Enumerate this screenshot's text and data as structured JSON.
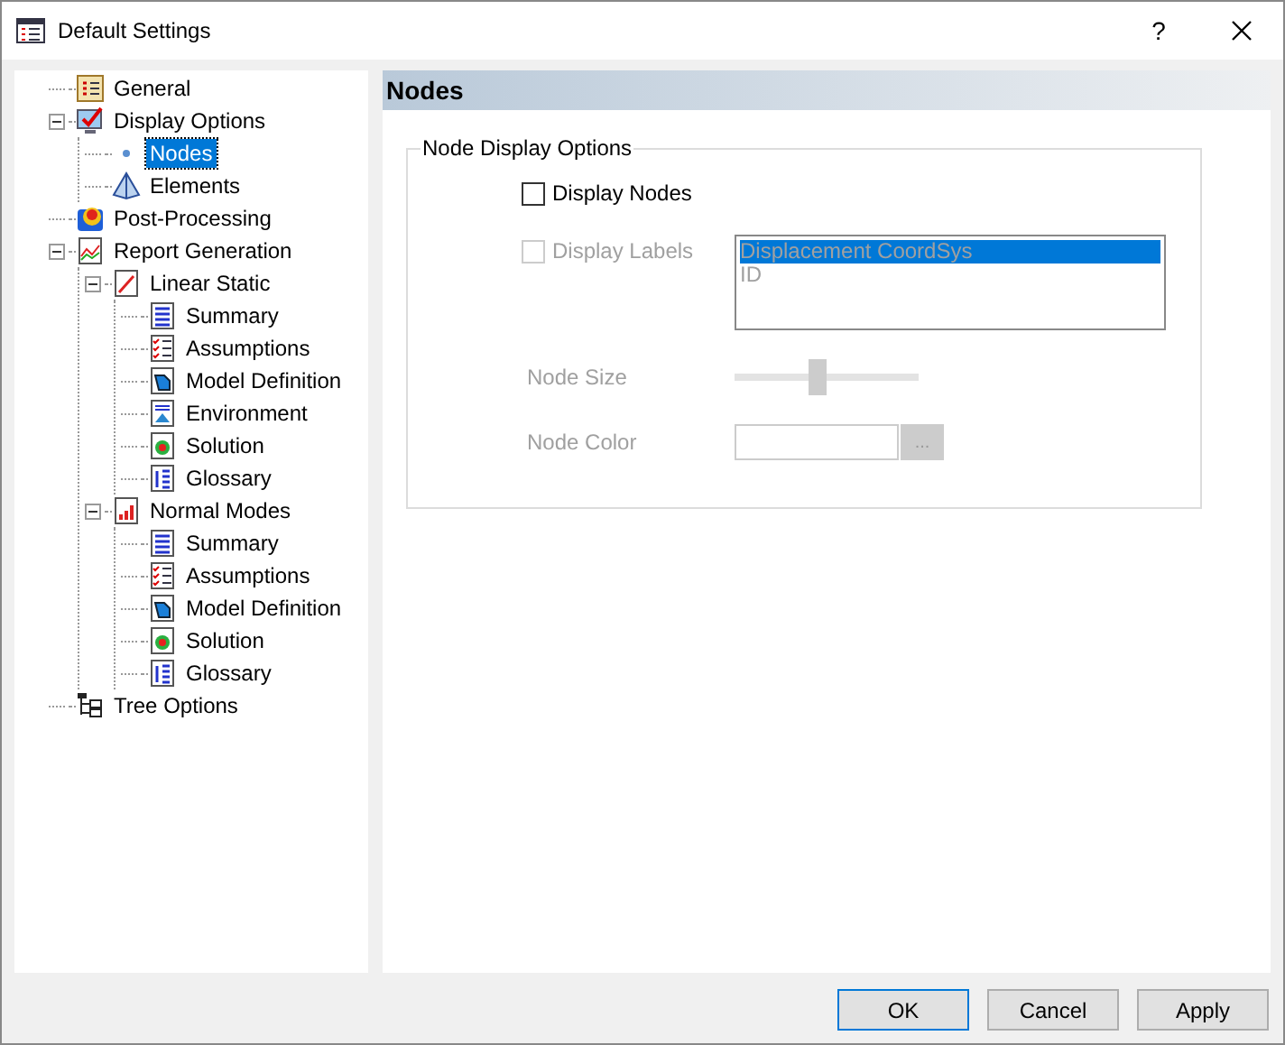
{
  "window": {
    "title": "Default Settings",
    "help": "?"
  },
  "tree": [
    {
      "label": "General",
      "kind": "checklist",
      "selected": false
    },
    {
      "label": "Display Options",
      "kind": "display",
      "selected": false,
      "expanded": true,
      "children": [
        {
          "label": "Nodes",
          "kind": "dot",
          "selected": true
        },
        {
          "label": "Elements",
          "kind": "pyramid",
          "selected": false
        }
      ]
    },
    {
      "label": "Post-Processing",
      "kind": "contour",
      "selected": false
    },
    {
      "label": "Report Generation",
      "kind": "report",
      "selected": false,
      "expanded": true,
      "children": [
        {
          "label": "Linear Static",
          "kind": "linechart",
          "selected": false,
          "expanded": true,
          "children": [
            {
              "label": "Summary",
              "kind": "summary",
              "selected": false
            },
            {
              "label": "Assumptions",
              "kind": "checklist2",
              "selected": false
            },
            {
              "label": "Model Definition",
              "kind": "model",
              "selected": false
            },
            {
              "label": "Environment",
              "kind": "environment",
              "selected": false
            },
            {
              "label": "Solution",
              "kind": "solution",
              "selected": false
            },
            {
              "label": "Glossary",
              "kind": "glossary",
              "selected": false
            }
          ]
        },
        {
          "label": "Normal Modes",
          "kind": "barchart",
          "selected": false,
          "expanded": true,
          "children": [
            {
              "label": "Summary",
              "kind": "summary",
              "selected": false
            },
            {
              "label": "Assumptions",
              "kind": "checklist2",
              "selected": false
            },
            {
              "label": "Model Definition",
              "kind": "model",
              "selected": false
            },
            {
              "label": "Solution",
              "kind": "solution",
              "selected": false
            },
            {
              "label": "Glossary",
              "kind": "glossary",
              "selected": false
            }
          ]
        }
      ]
    },
    {
      "label": "Tree Options",
      "kind": "treeopts",
      "selected": false
    }
  ],
  "panel": {
    "title": "Nodes",
    "group": {
      "title": "Node Display Options",
      "display_nodes": {
        "label": "Display Nodes",
        "checked": false,
        "disabled": false
      },
      "display_labels": {
        "label": "Display Labels",
        "checked": false,
        "disabled": true
      },
      "label_list": [
        {
          "label": "Displacement CoordSys",
          "selected": true
        },
        {
          "label": "ID",
          "selected": false
        }
      ],
      "node_size": {
        "label": "Node Size",
        "level": 0.45
      },
      "node_color": {
        "label": "Node Color",
        "browse": "..."
      }
    }
  },
  "buttons": [
    "OK",
    "Cancel",
    "Apply"
  ]
}
